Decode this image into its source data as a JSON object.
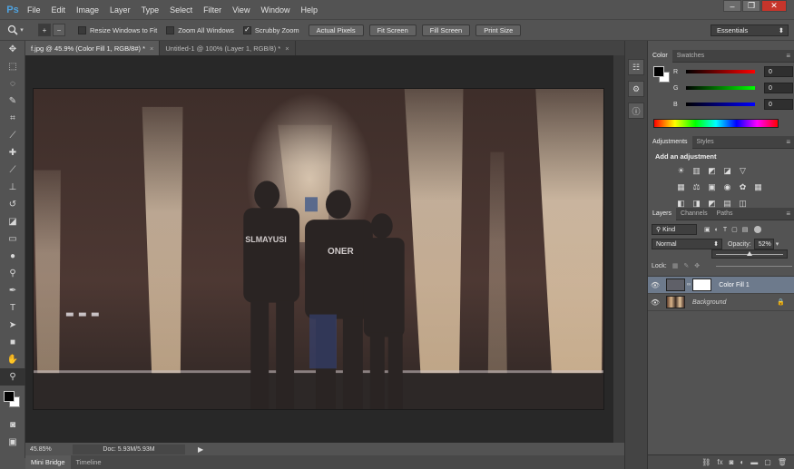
{
  "app": {
    "logo": "Ps"
  },
  "menu": [
    "File",
    "Edit",
    "Image",
    "Layer",
    "Type",
    "Select",
    "Filter",
    "View",
    "Window",
    "Help"
  ],
  "window_controls": {
    "minimize": "–",
    "restore": "❐",
    "close": "✕"
  },
  "options": {
    "resize_windows": "Resize Windows to Fit",
    "zoom_all": "Zoom All Windows",
    "scrubby": "Scrubby Zoom",
    "scrubby_checked": "✓",
    "actual_pixels": "Actual Pixels",
    "fit_screen": "Fit Screen",
    "fill_screen": "Fill Screen",
    "print_size": "Print Size",
    "workspace": "Essentials"
  },
  "tabs": [
    {
      "label": "f.jpg @ 45.9% (Color Fill 1, RGB/8#) *",
      "close": "×"
    },
    {
      "label": "Untitled-1 @ 100% (Layer 1, RGB/8) *",
      "close": "×"
    }
  ],
  "status": {
    "zoom": "45.85%",
    "doc": "Doc: 5.93M/5.93M"
  },
  "bottom_tabs": [
    "Mini Bridge",
    "Timeline"
  ],
  "photo_text": {
    "jersey1": "SLMAYUSI",
    "jersey2": "ONER"
  },
  "color_panel": {
    "tabs": [
      "Color",
      "Swatches"
    ],
    "r_label": "R",
    "r_value": "0",
    "g_label": "G",
    "g_value": "0",
    "b_label": "B",
    "b_value": "0"
  },
  "adjustments_panel": {
    "tabs": [
      "Adjustments",
      "Styles"
    ],
    "title": "Add an adjustment"
  },
  "layers_panel": {
    "tabs": [
      "Layers",
      "Channels",
      "Paths"
    ],
    "kind": "Kind",
    "blend_mode": "Normal",
    "opacity_label": "Opacity:",
    "opacity_value": "52%",
    "lock_label": "Lock:",
    "layers": [
      {
        "name": "Color Fill 1",
        "selected": true
      },
      {
        "name": "Background",
        "selected": false
      }
    ]
  }
}
